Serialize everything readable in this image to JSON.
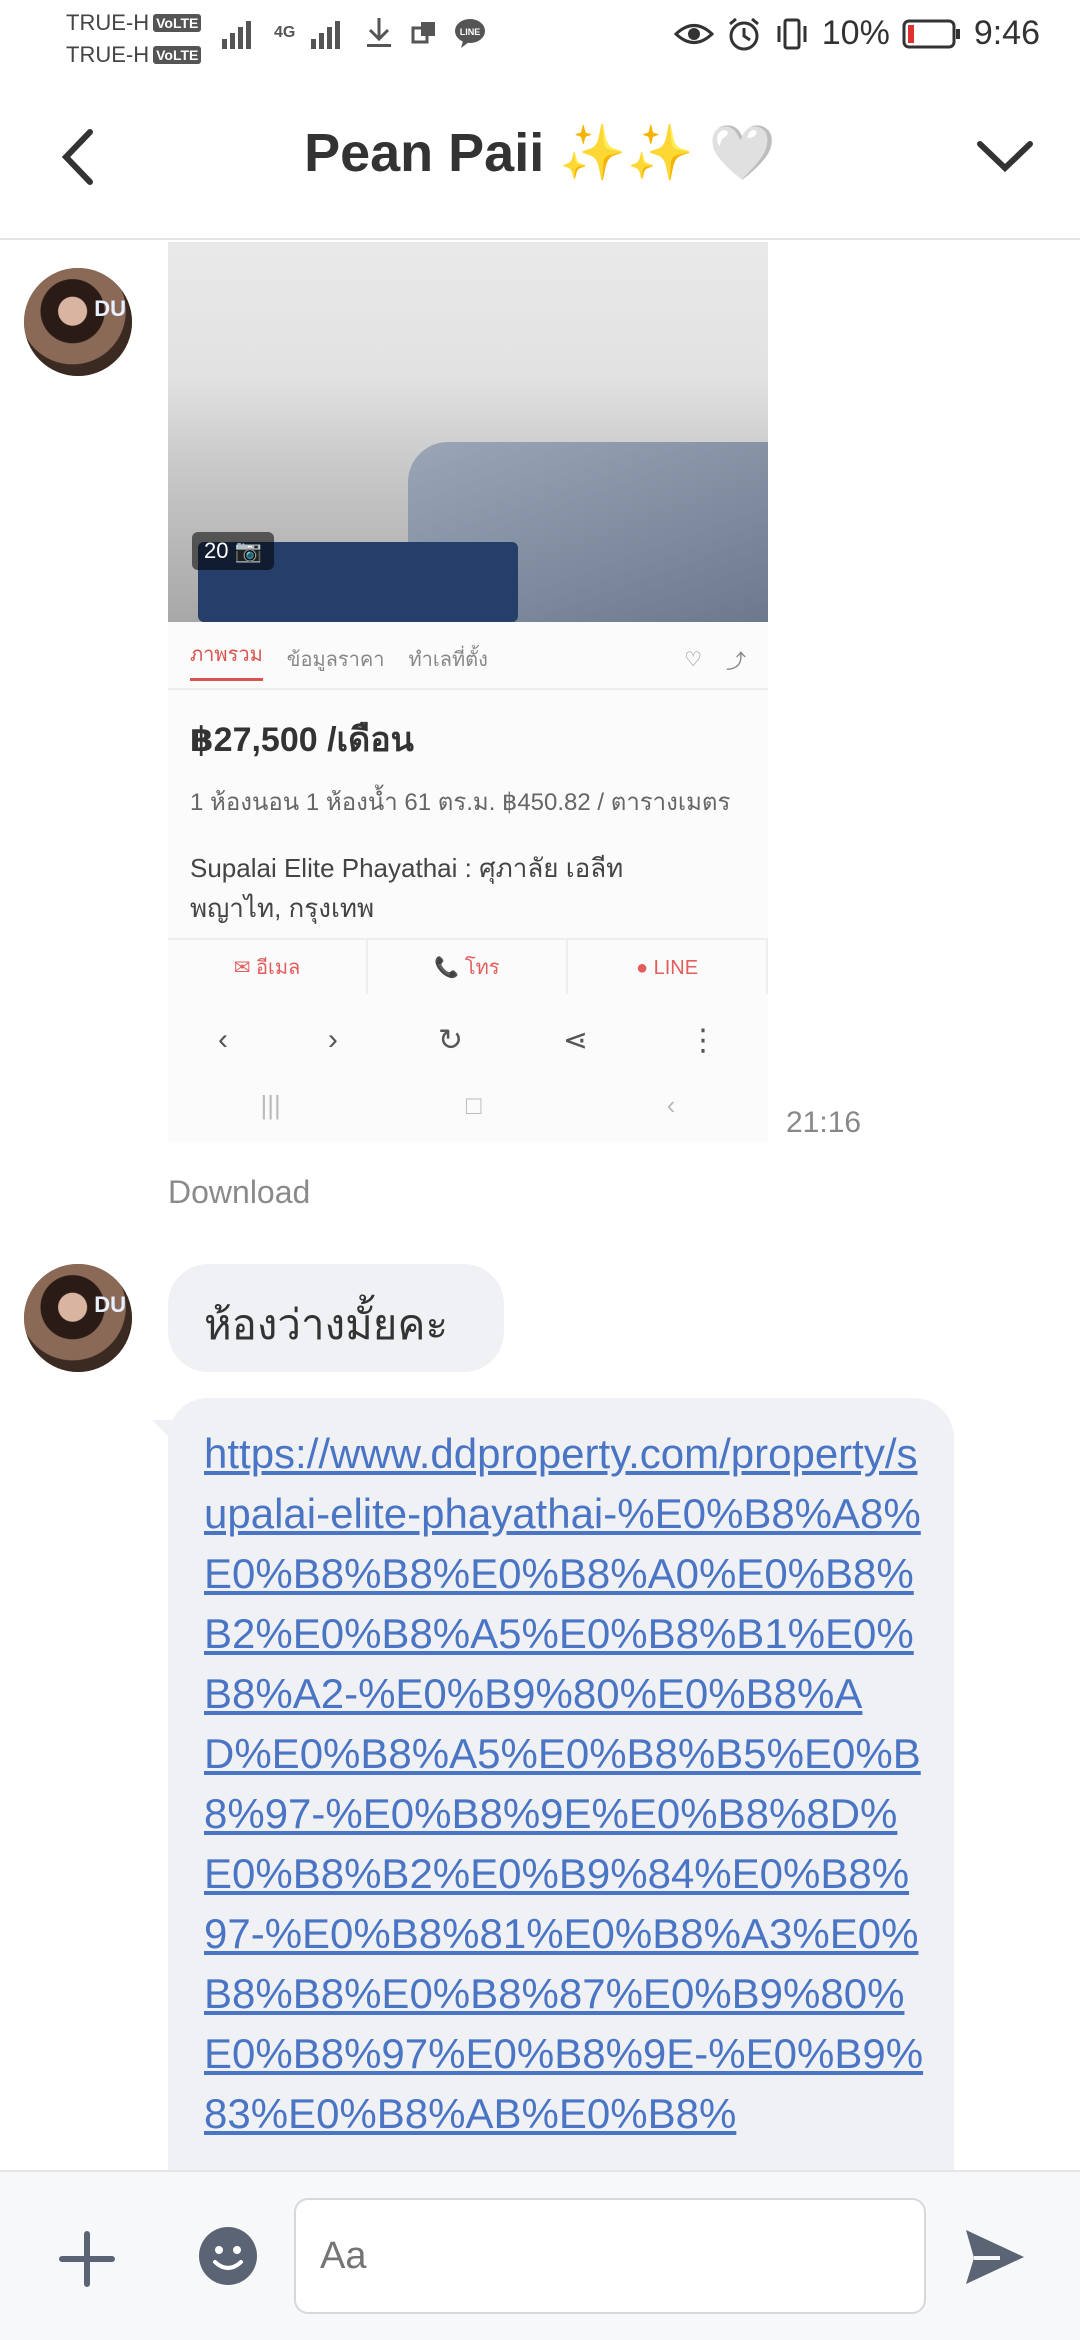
{
  "status_bar": {
    "carrier_1": "TRUE-H",
    "carrier_2": "TRUE-H",
    "volte": "VoLTE",
    "network": "4G",
    "battery": "10%",
    "time": "9:46",
    "icons": [
      "signal-icon",
      "download-icon",
      "line-icon",
      "eye-icon",
      "alarm-icon",
      "vibrate-icon",
      "battery-icon"
    ]
  },
  "header": {
    "title": "Pean Paii ✨✨ 🤍"
  },
  "messages": {
    "screenshot": {
      "photo_badge": "20 📷",
      "tabs": [
        "ภาพรวม",
        "ข้อมูลราคา",
        "ทำเลที่ตั้ง"
      ],
      "price": "฿27,500 /เดือน",
      "meta": "1 ห้องนอน  1 ห้องน้ำ  61 ตร.ม.  ฿450.82 / ตารางเมตร",
      "name": "Supalai Elite Phayathai : ศุภาลัย เอลีท พญาไท, กรุงเทพ",
      "actions": [
        "✉ อีเมล",
        "📞 โทร",
        "● LINE"
      ]
    },
    "time_1": "21:16",
    "download_label": "Download",
    "text_1": "ห้องว่างมั้ยคะ",
    "link_text": "https://www.ddproperty.com/property/supalai-elite-phayathai-%E0%B8%A8%E0%B8%B8%E0%B8%A0%E0%B8%B2%E0%B8%A5%E0%B8%B1%E0%B8%A2-%E0%B9%80%E0%B8%AD%E0%B8%A5%E0%B8%B5%E0%B8%97-%E0%B8%9E%E0%B8%8D%E0%B8%B2%E0%B9%84%E0%B8%97-%E0%B8%81%E0%B8%A3%E0%B8%B8%E0%B8%87%E0%B9%80%E0%B8%97%E0%B8%9E-%E0%B9%83%E0%B8%AB%E0%B8%"
  },
  "composer": {
    "placeholder": "Aa"
  },
  "colors": {
    "bubble": "#eff1f4",
    "link": "#4a74c4",
    "icon_dark": "#5b6475"
  }
}
